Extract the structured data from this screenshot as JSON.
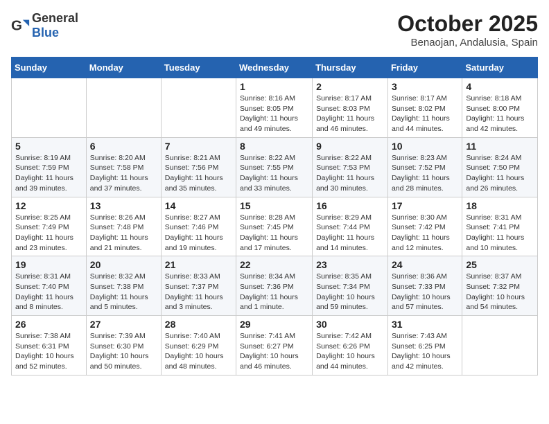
{
  "header": {
    "logo_general": "General",
    "logo_blue": "Blue",
    "month_title": "October 2025",
    "subtitle": "Benaojan, Andalusia, Spain"
  },
  "days_of_week": [
    "Sunday",
    "Monday",
    "Tuesday",
    "Wednesday",
    "Thursday",
    "Friday",
    "Saturday"
  ],
  "weeks": [
    [
      {
        "day": "",
        "info": ""
      },
      {
        "day": "",
        "info": ""
      },
      {
        "day": "",
        "info": ""
      },
      {
        "day": "1",
        "info": "Sunrise: 8:16 AM\nSunset: 8:05 PM\nDaylight: 11 hours\nand 49 minutes."
      },
      {
        "day": "2",
        "info": "Sunrise: 8:17 AM\nSunset: 8:03 PM\nDaylight: 11 hours\nand 46 minutes."
      },
      {
        "day": "3",
        "info": "Sunrise: 8:17 AM\nSunset: 8:02 PM\nDaylight: 11 hours\nand 44 minutes."
      },
      {
        "day": "4",
        "info": "Sunrise: 8:18 AM\nSunset: 8:00 PM\nDaylight: 11 hours\nand 42 minutes."
      }
    ],
    [
      {
        "day": "5",
        "info": "Sunrise: 8:19 AM\nSunset: 7:59 PM\nDaylight: 11 hours\nand 39 minutes."
      },
      {
        "day": "6",
        "info": "Sunrise: 8:20 AM\nSunset: 7:58 PM\nDaylight: 11 hours\nand 37 minutes."
      },
      {
        "day": "7",
        "info": "Sunrise: 8:21 AM\nSunset: 7:56 PM\nDaylight: 11 hours\nand 35 minutes."
      },
      {
        "day": "8",
        "info": "Sunrise: 8:22 AM\nSunset: 7:55 PM\nDaylight: 11 hours\nand 33 minutes."
      },
      {
        "day": "9",
        "info": "Sunrise: 8:22 AM\nSunset: 7:53 PM\nDaylight: 11 hours\nand 30 minutes."
      },
      {
        "day": "10",
        "info": "Sunrise: 8:23 AM\nSunset: 7:52 PM\nDaylight: 11 hours\nand 28 minutes."
      },
      {
        "day": "11",
        "info": "Sunrise: 8:24 AM\nSunset: 7:50 PM\nDaylight: 11 hours\nand 26 minutes."
      }
    ],
    [
      {
        "day": "12",
        "info": "Sunrise: 8:25 AM\nSunset: 7:49 PM\nDaylight: 11 hours\nand 23 minutes."
      },
      {
        "day": "13",
        "info": "Sunrise: 8:26 AM\nSunset: 7:48 PM\nDaylight: 11 hours\nand 21 minutes."
      },
      {
        "day": "14",
        "info": "Sunrise: 8:27 AM\nSunset: 7:46 PM\nDaylight: 11 hours\nand 19 minutes."
      },
      {
        "day": "15",
        "info": "Sunrise: 8:28 AM\nSunset: 7:45 PM\nDaylight: 11 hours\nand 17 minutes."
      },
      {
        "day": "16",
        "info": "Sunrise: 8:29 AM\nSunset: 7:44 PM\nDaylight: 11 hours\nand 14 minutes."
      },
      {
        "day": "17",
        "info": "Sunrise: 8:30 AM\nSunset: 7:42 PM\nDaylight: 11 hours\nand 12 minutes."
      },
      {
        "day": "18",
        "info": "Sunrise: 8:31 AM\nSunset: 7:41 PM\nDaylight: 11 hours\nand 10 minutes."
      }
    ],
    [
      {
        "day": "19",
        "info": "Sunrise: 8:31 AM\nSunset: 7:40 PM\nDaylight: 11 hours\nand 8 minutes."
      },
      {
        "day": "20",
        "info": "Sunrise: 8:32 AM\nSunset: 7:38 PM\nDaylight: 11 hours\nand 5 minutes."
      },
      {
        "day": "21",
        "info": "Sunrise: 8:33 AM\nSunset: 7:37 PM\nDaylight: 11 hours\nand 3 minutes."
      },
      {
        "day": "22",
        "info": "Sunrise: 8:34 AM\nSunset: 7:36 PM\nDaylight: 11 hours\nand 1 minute."
      },
      {
        "day": "23",
        "info": "Sunrise: 8:35 AM\nSunset: 7:34 PM\nDaylight: 10 hours\nand 59 minutes."
      },
      {
        "day": "24",
        "info": "Sunrise: 8:36 AM\nSunset: 7:33 PM\nDaylight: 10 hours\nand 57 minutes."
      },
      {
        "day": "25",
        "info": "Sunrise: 8:37 AM\nSunset: 7:32 PM\nDaylight: 10 hours\nand 54 minutes."
      }
    ],
    [
      {
        "day": "26",
        "info": "Sunrise: 7:38 AM\nSunset: 6:31 PM\nDaylight: 10 hours\nand 52 minutes."
      },
      {
        "day": "27",
        "info": "Sunrise: 7:39 AM\nSunset: 6:30 PM\nDaylight: 10 hours\nand 50 minutes."
      },
      {
        "day": "28",
        "info": "Sunrise: 7:40 AM\nSunset: 6:29 PM\nDaylight: 10 hours\nand 48 minutes."
      },
      {
        "day": "29",
        "info": "Sunrise: 7:41 AM\nSunset: 6:27 PM\nDaylight: 10 hours\nand 46 minutes."
      },
      {
        "day": "30",
        "info": "Sunrise: 7:42 AM\nSunset: 6:26 PM\nDaylight: 10 hours\nand 44 minutes."
      },
      {
        "day": "31",
        "info": "Sunrise: 7:43 AM\nSunset: 6:25 PM\nDaylight: 10 hours\nand 42 minutes."
      },
      {
        "day": "",
        "info": ""
      }
    ]
  ]
}
